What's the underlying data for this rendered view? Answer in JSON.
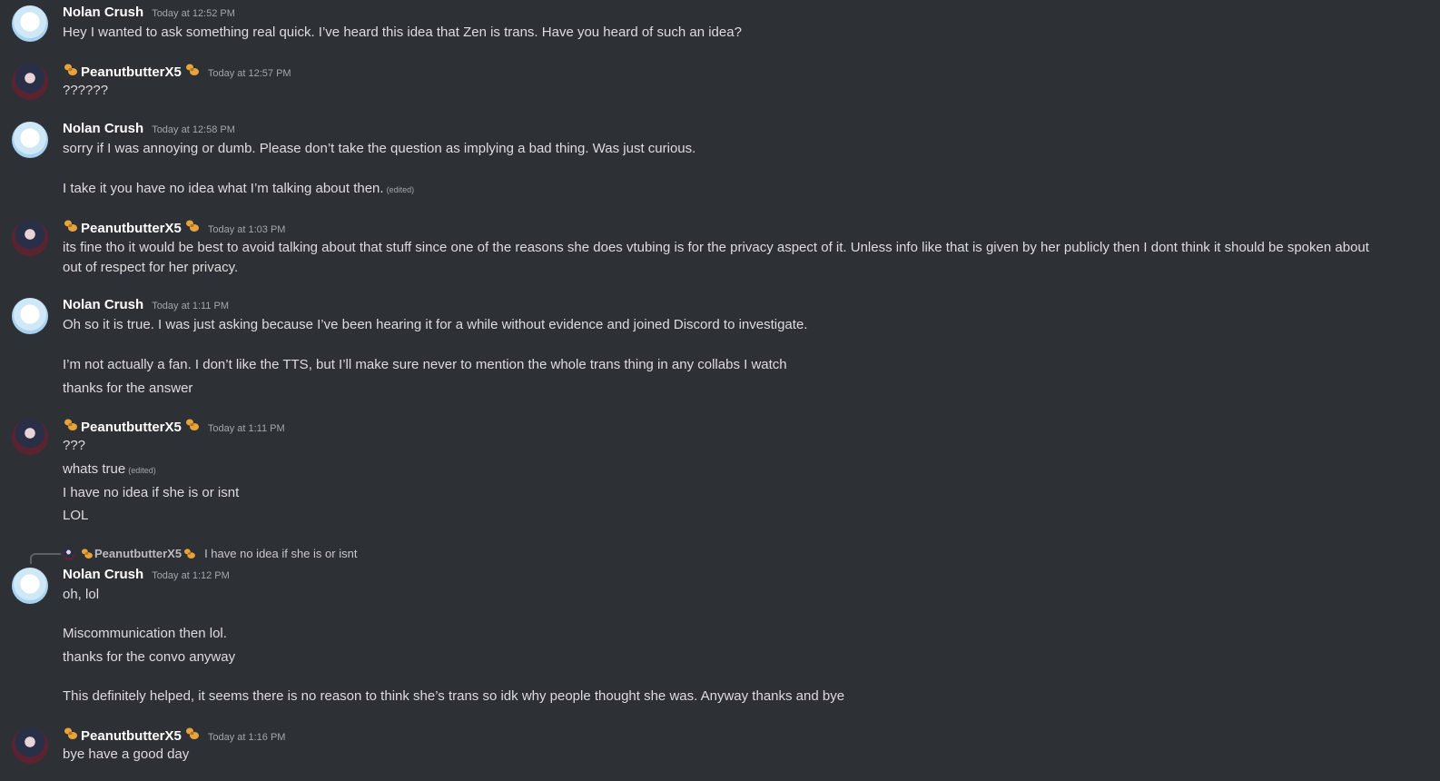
{
  "colors": {
    "background": "#2d3034",
    "username": "#ffffff",
    "message_text": "#dcddde",
    "timestamp": "#a3a6aa",
    "badge": "#e8a33a"
  },
  "icons": {
    "badge": "peanut-badge-icon"
  },
  "edited_label": "(edited)",
  "reply": {
    "author": "PeanutbutterX5",
    "text": "I have no idea if she is or isnt"
  },
  "messages": [
    {
      "author": "Nolan Crush",
      "time": "Today at 12:52 PM",
      "lines": [
        "Hey I wanted to ask something real quick. I’ve heard this idea that Zen is trans. Have you heard of such an idea?"
      ]
    },
    {
      "author": "PeanutbutterX5",
      "time": "Today at 12:57 PM",
      "lines": [
        "??????"
      ]
    },
    {
      "author": "Nolan Crush",
      "time": "Today at 12:58 PM",
      "lines": [
        "sorry if I was annoying or dumb. Please don’t take the question as implying a bad thing. Was just curious.",
        "I take it you have no idea what I’m talking about then."
      ]
    },
    {
      "author": "PeanutbutterX5",
      "time": "Today at 1:03 PM",
      "lines": [
        "its fine tho it would be best to avoid talking about that stuff since one of the reasons she does vtubing is for the privacy aspect of it. Unless info like that is given by her publicly then I dont think it should be spoken about out of respect for her privacy."
      ]
    },
    {
      "author": "Nolan Crush",
      "time": "Today at 1:11 PM",
      "lines": [
        "Oh so it is true. I was just asking because I’ve been hearing it for a while without evidence and joined Discord to investigate.",
        "I’m not actually a fan. I don’t like the TTS, but I’ll make sure never to mention the whole trans thing in any collabs I watch",
        "thanks for the answer"
      ]
    },
    {
      "author": "PeanutbutterX5",
      "time": "Today at 1:11 PM",
      "lines": [
        "???",
        "whats true",
        "I have no idea if she is or isnt",
        "LOL"
      ]
    },
    {
      "author": "Nolan Crush",
      "time": "Today at 1:12 PM",
      "lines": [
        "oh, lol",
        "Miscommunication then lol.",
        "thanks for the convo anyway",
        "This definitely helped, it seems there is no reason to think she’s trans so idk why people thought she was. Anyway thanks and bye"
      ]
    },
    {
      "author": "PeanutbutterX5",
      "time": "Today at 1:16 PM",
      "lines": [
        "bye have a good day"
      ]
    }
  ]
}
